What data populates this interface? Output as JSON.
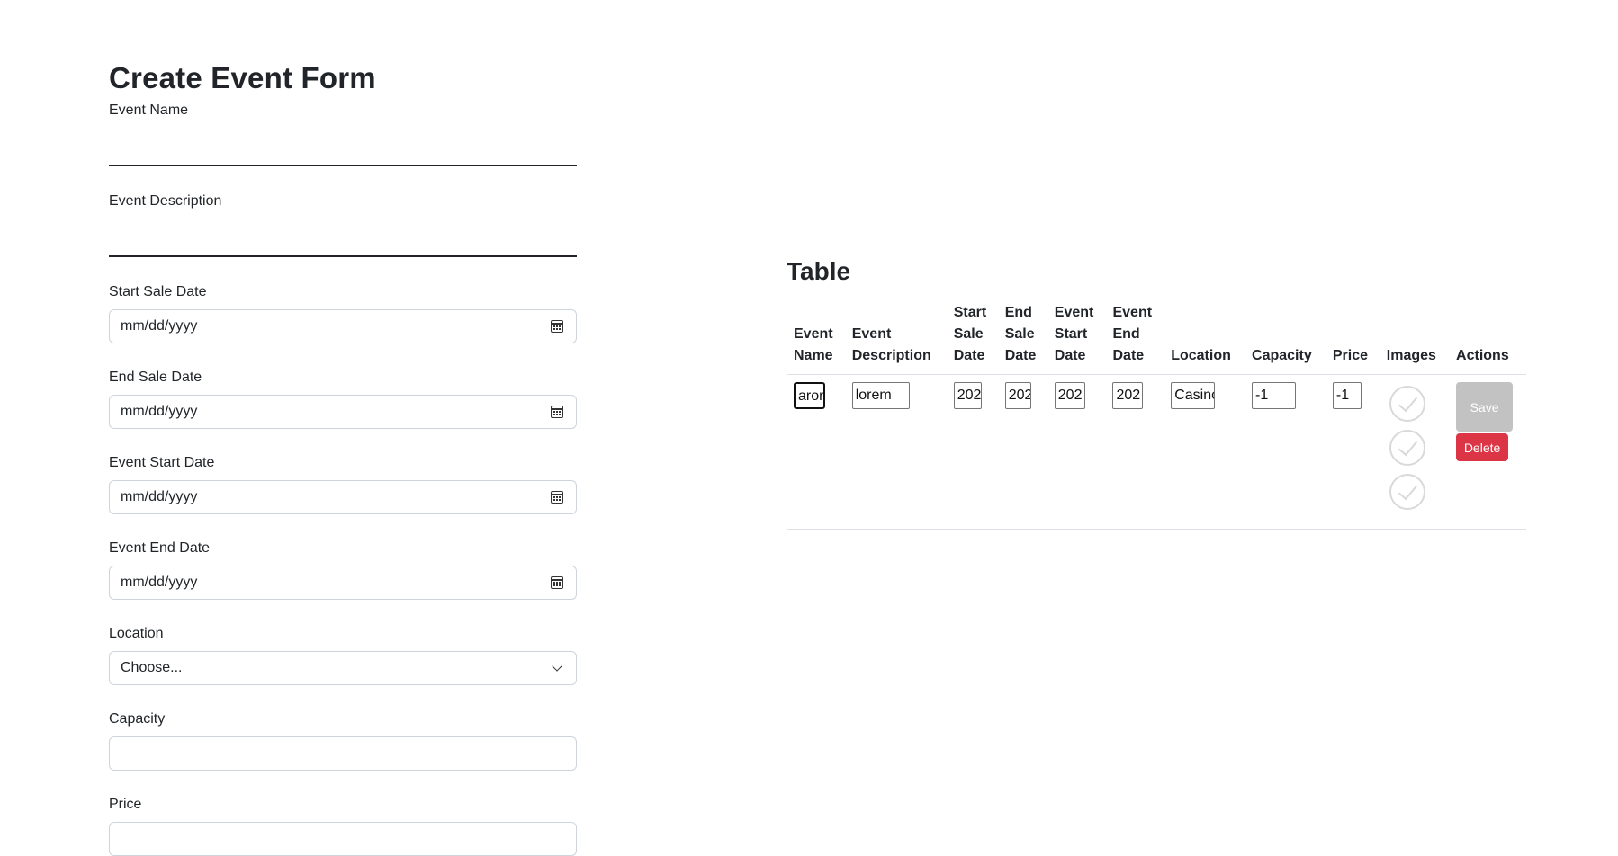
{
  "form": {
    "title": "Create Event Form",
    "event_name": {
      "label": "Event Name",
      "value": ""
    },
    "event_description": {
      "label": "Event Description",
      "value": ""
    },
    "start_sale_date": {
      "label": "Start Sale Date",
      "placeholder": "mm/dd/yyyy"
    },
    "end_sale_date": {
      "label": "End Sale Date",
      "placeholder": "mm/dd/yyyy"
    },
    "event_start_date": {
      "label": "Event Start Date",
      "placeholder": "mm/dd/yyyy"
    },
    "event_end_date": {
      "label": "Event End Date",
      "placeholder": "mm/dd/yyyy"
    },
    "location": {
      "label": "Location",
      "selected": "Choose..."
    },
    "capacity": {
      "label": "Capacity",
      "value": ""
    },
    "price": {
      "label": "Price",
      "value": ""
    }
  },
  "table": {
    "title": "Table",
    "headers": {
      "event_name": [
        "Event",
        "Name"
      ],
      "event_description": [
        "Event",
        "Description"
      ],
      "start_sale_date": [
        "Start",
        "Sale",
        "Date"
      ],
      "end_sale_date": [
        "End",
        "Sale",
        "Date"
      ],
      "event_start_date": [
        "Event",
        "Start",
        "Date"
      ],
      "event_end_date": [
        "Event",
        "End",
        "Date"
      ],
      "location": [
        "Location"
      ],
      "capacity": [
        "Capacity"
      ],
      "price": [
        "Price"
      ],
      "images": [
        "Images"
      ],
      "actions": [
        "Actions"
      ]
    },
    "rows": [
      {
        "event_name": "aron",
        "event_description": "lorem",
        "start_sale_date": "202",
        "end_sale_date": "202",
        "event_start_date": "202",
        "event_end_date": "202",
        "location": "Casino",
        "capacity": "-1",
        "price": "-1",
        "images": [
          "check-circle-icon",
          "check-circle-icon",
          "check-circle-icon"
        ],
        "save_label": "Save",
        "delete_label": "Delete"
      }
    ]
  },
  "colors": {
    "text": "#212529",
    "delete": "#dc3545",
    "save_disabled": "#c2c2c2",
    "border": "#ced4da"
  }
}
